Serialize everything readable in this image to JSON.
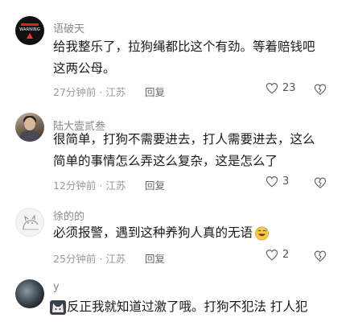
{
  "comments": [
    {
      "username": "语破天",
      "avatar_icon": "warning-avatar",
      "avatar_text": "WARNING",
      "text_lines": [
        "给我整乐了，拉狗绳都比这个有劲。等着赔钱吧",
        "这两公母。"
      ],
      "time": "27分钟前",
      "location": "江苏",
      "reply_label": "回复",
      "likes": "23"
    },
    {
      "username": "陆大壹贰叁",
      "avatar_icon": "photo-avatar",
      "text_lines": [
        "很简单，打狗不需要进去，打人需要进去，这么",
        "简单的事情怎么弄这么复杂，这是怎么了"
      ],
      "time": "12分钟前",
      "location": "江苏",
      "reply_label": "回复",
      "likes": "3"
    },
    {
      "username": "徐的的",
      "avatar_icon": "sketch-avatar",
      "text_lines": [
        "必须报警，遇到这种养狗人真的无语"
      ],
      "emoji": "sweat-smile-emoji",
      "time": "25分钟前",
      "location": "江苏",
      "reply_label": "回复",
      "likes": "2"
    },
    {
      "username": "y",
      "avatar_icon": "planet-avatar",
      "text_lines": [
        "反正我就知道过激了哦。打狗不犯法 打人犯"
      ],
      "emoji": "cat-emoji"
    }
  ],
  "separator": "·",
  "colors": {
    "meta": "#9a9a9a",
    "username": "#8a8a8a",
    "text": "#1a1a1a"
  }
}
